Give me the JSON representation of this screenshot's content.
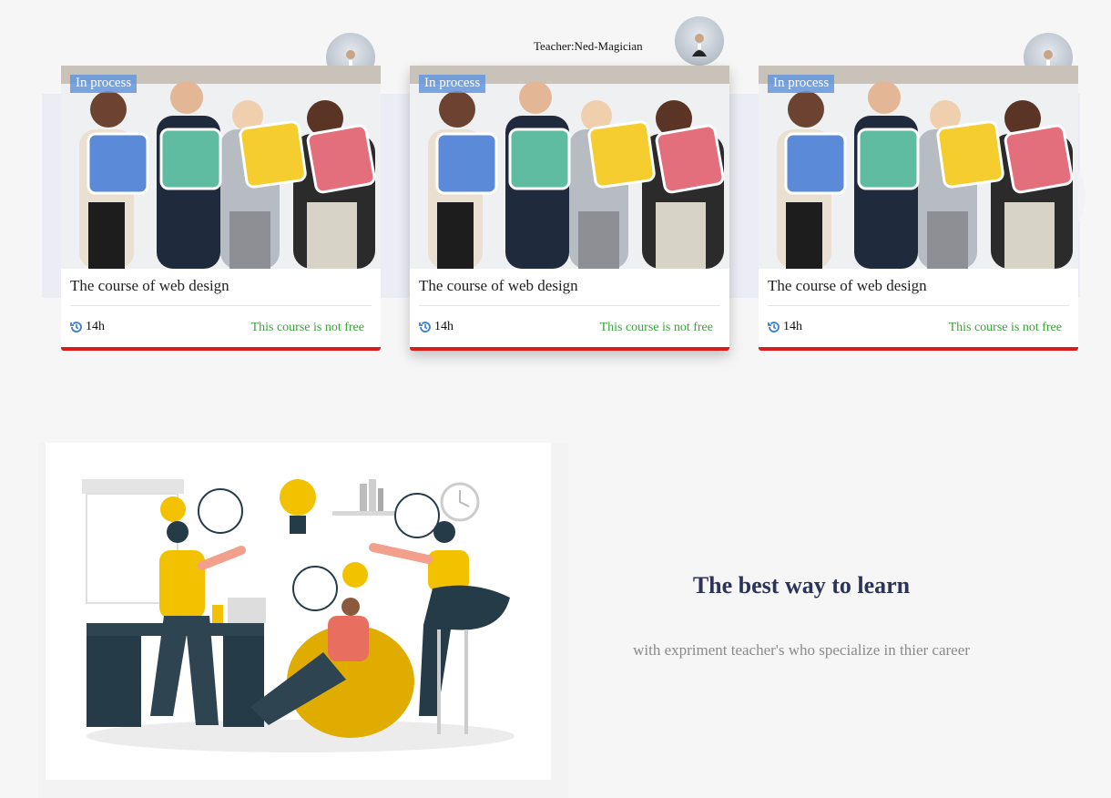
{
  "teacher": {
    "label": "Teacher:Ned-Magician"
  },
  "cards": [
    {
      "badge": "In process",
      "title": "The course of web design",
      "duration": "14h",
      "price_note": "This course is not free"
    },
    {
      "badge": "In process",
      "title": "The course of web design",
      "duration": "14h",
      "price_note": "This course is not free"
    },
    {
      "badge": "In process",
      "title": "The course of web design",
      "duration": "14h",
      "price_note": "This course is not free"
    }
  ],
  "promo": {
    "title": "The best way to learn",
    "subtitle": "with expriment teacher's who specialize in thier career"
  },
  "colors": {
    "background": "#f6f6f6",
    "accent_red": "#d81b1b",
    "price_green": "#3aa33a",
    "badge_blue": "#6496dc",
    "promo_title": "#2c3458",
    "clock_blue": "#3a7bd5"
  },
  "icons": {
    "duration": "history-clock-icon"
  }
}
